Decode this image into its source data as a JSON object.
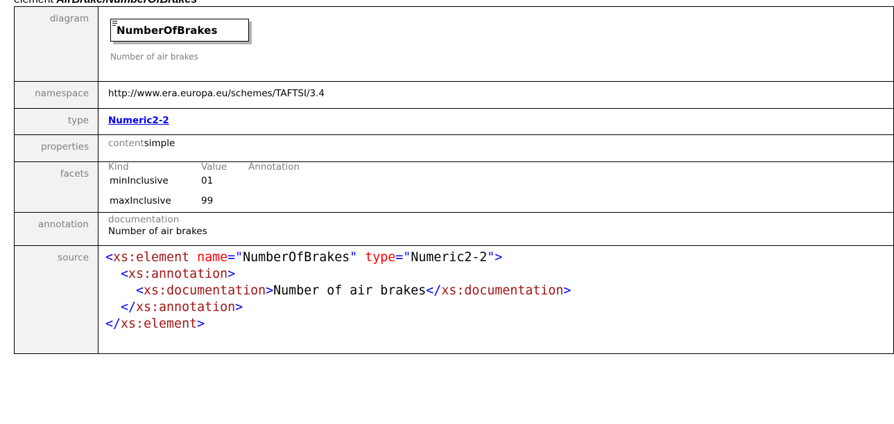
{
  "heading": {
    "prefix": "element ",
    "name": "AirBrake/NumberOfBrakes"
  },
  "labels": {
    "diagram": "diagram",
    "namespace": "namespace",
    "type": "type",
    "properties": "properties",
    "facets": "facets",
    "annotation": "annotation",
    "source": "source"
  },
  "diagram": {
    "element_name": "NumberOfBrakes",
    "note": "Number of air brakes"
  },
  "namespace": "http://www.era.europa.eu/schemes/TAFTSI/3.4",
  "type": "Numeric2-2",
  "properties": {
    "key": "content",
    "value": "simple"
  },
  "facets": {
    "headers": [
      "Kind",
      "Value",
      "Annotation"
    ],
    "rows": [
      {
        "kind": "minInclusive",
        "value": "01"
      },
      {
        "kind": "maxInclusive",
        "value": "99"
      }
    ]
  },
  "annotation": {
    "header": "documentation",
    "text": "Number of air brakes"
  },
  "source": {
    "l1_open": "<",
    "l1_tag": "xs:element",
    "l1_attr1": "name",
    "l1_eq": "=\"",
    "l1_val1": "NumberOfBrakes",
    "l1_close1": "\"",
    "l1_attr2": "type",
    "l1_val2": "Numeric2-2",
    "l1_end": "\">",
    "l2_tag": "xs:annotation",
    "l3_tag": "xs:documentation",
    "l3_text": "Number of air brakes",
    "l4_tag": "xs:annotation",
    "l5_tag": "xs:element"
  }
}
